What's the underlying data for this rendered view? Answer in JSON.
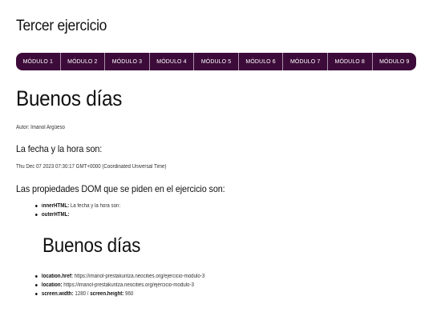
{
  "header": {
    "title": "Tercer ejercicio"
  },
  "nav": {
    "items": [
      "MÓDULO 1",
      "MÓDULO 2",
      "MÓDULO 3",
      "MÓDULO 4",
      "MÓDULO 5",
      "MÓDULO 6",
      "MÓDULO 7",
      "MÓDULO 8",
      "MÓDULO 9"
    ],
    "background_color": "#3d0b3a",
    "text_color": "#ffffff"
  },
  "main": {
    "greeting": "Buenos días",
    "author": "Autor: Imanol Argüeso",
    "date_heading": "La fecha y la hora son:",
    "date_value": "Thu Dec 07 2023 07:30:17 GMT+0000 (Coordinated Universal Time)",
    "props_heading": "Las propiedades DOM que se piden en el ejercicio son:",
    "dom_props": {
      "inner_label": "innerHTML:",
      "inner_value": "La fecha y la hora son:",
      "outer_label": "outerHTML:"
    },
    "outer_greeting": "Buenos días",
    "location": {
      "href_label": "location.href:",
      "href_value": "https://imanol-prestakuntza.neocities.org/ejercicio-modulo-3",
      "loc_label": "location:",
      "loc_value": "https://imanol-prestakuntza.neocities.org/ejercicio-modulo-3",
      "width_label": "screen.width:",
      "width_value": "1280",
      "separator": "/",
      "height_label": "screen.height:",
      "height_value": "960"
    }
  }
}
